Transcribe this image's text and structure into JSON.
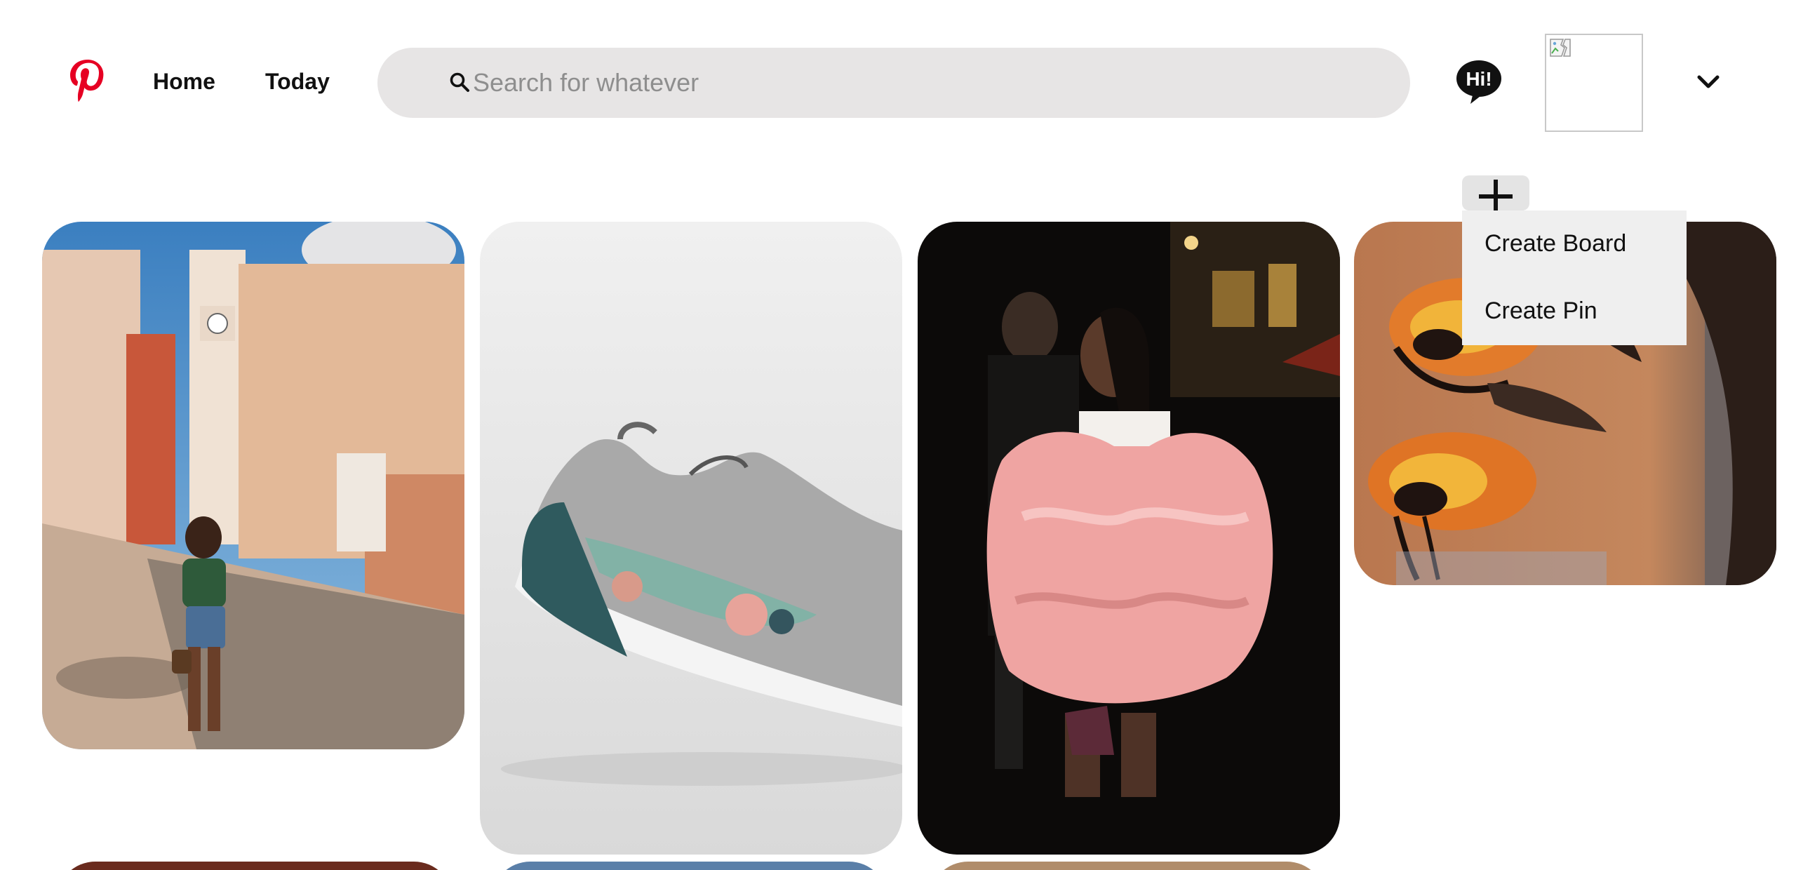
{
  "header": {
    "logo_icon": "pinterest-logo-icon",
    "nav": {
      "home_label": "Home",
      "today_label": "Today"
    },
    "search": {
      "placeholder": "Search for whatever",
      "value": "",
      "icon": "search-icon"
    },
    "messages_icon": "hi-chat-bubble-icon",
    "avatar_icon": "broken-image-icon",
    "menu_icon": "chevron-down-icon"
  },
  "add_menu": {
    "button_icon": "plus-icon",
    "items": [
      {
        "label": "Create Board"
      },
      {
        "label": "Create Pin"
      }
    ]
  },
  "colors": {
    "brand": "#e60023",
    "search_bg": "#e7e5e5",
    "menu_bg": "#efefef",
    "text": "#111111",
    "placeholder": "#8e8e8e"
  },
  "pins": [
    {
      "name": "pin-woman-street"
    },
    {
      "name": "pin-sneaker"
    },
    {
      "name": "pin-pink-jacket"
    },
    {
      "name": "pin-eye-makeup"
    }
  ]
}
